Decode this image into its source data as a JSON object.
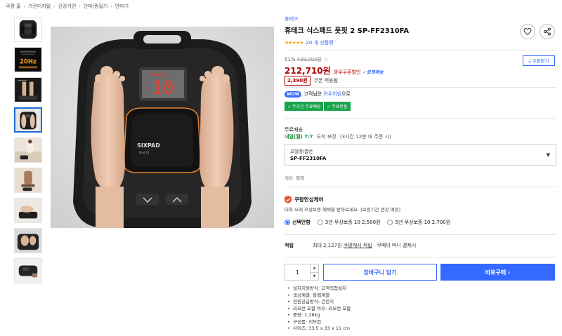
{
  "breadcrumb": [
    "쿠팡 홈",
    "가전디지털",
    "건강가전",
    "안마/찜질기",
    "안마기"
  ],
  "product": {
    "brand": "휴테크",
    "title": "휴테크 식스패드 풋핏 2 SP-FF2310FA",
    "stars": "★★★★★",
    "review_count": "20 개 상품평"
  },
  "price": {
    "discount_rate": "51%",
    "original": "439,000원",
    "info_icon": "ⓘ",
    "sale": "212,710원",
    "coupon_label": "와우쿠폰할인",
    "rocket": "✓로켓배송",
    "coupon_tag": "2,390원",
    "coupon_apply": "쿠폰 적용됨",
    "coupon_button": "⤓ 쿠폰받기"
  },
  "wow": {
    "badge": "WOW",
    "prefix": "고객님은 ",
    "highlight": "와우회원",
    "suffix": "으로"
  },
  "benefits": [
    "✓ 무조건 무료배송",
    "✓ 무료반품"
  ],
  "shipping": {
    "label": "무료배송",
    "date": "내일(월) 7/7",
    "guarantee": "도착 보장",
    "note": "(3시간 12분 내 주문 시)"
  },
  "option": {
    "label1": "모델명/품번",
    "label2": "SP-FF2310FA",
    "caret": "▼"
  },
  "color": "색상: 블랙",
  "care": {
    "title": "쿠팡안심케어",
    "desc": "더욱 오래 무상보증 혜택을 받아보세요. (보증기간 연장 예정)",
    "options": [
      {
        "label": "선택안함",
        "checked": true
      },
      {
        "label": "3년 무상보증 10 2,500원",
        "checked": false
      },
      {
        "label": "5년 무상보증 10 2,700원",
        "checked": false
      }
    ]
  },
  "points": {
    "label": "적립",
    "prefix": "최대 2,127원 ",
    "link": "쿠팡캐시 적립",
    "suffix": " · 쿠페이 머니 결제시"
  },
  "purchase": {
    "quantity": "1",
    "up": "▲",
    "down": "▼",
    "cart": "장바구니 담기",
    "buy": "바로구매 ›"
  },
  "specs": [
    "설치지원방식: 고객직접설치",
    "색상계열: 블랙계열",
    "전원공급방식: 건전지",
    "리모컨 포함 여부: 리모컨 포함",
    "중량: 1.28kg",
    "구성품: 리모컨",
    "사이즈: 33.5 x 33 x 11 cm"
  ],
  "colors": {
    "accent": "#346aff",
    "price_red": "#ae0000",
    "benefit_green": "#19a34a",
    "display_red": "#f23a2a",
    "glow_orange": "#f08a30"
  },
  "main_image": {
    "display_value": "10",
    "display_label": "TRAINING",
    "brand_logo": "SIXPAD",
    "model_text": "Foot Fit"
  },
  "thumbs": [
    {
      "name": "thumb-device-top",
      "selected": false
    },
    {
      "name": "thumb-20hz-banner",
      "selected": false,
      "text": "20Hz"
    },
    {
      "name": "thumb-legs-dark",
      "selected": false
    },
    {
      "name": "thumb-feet-on-device",
      "selected": true
    },
    {
      "name": "thumb-woman-sofa",
      "selected": false
    },
    {
      "name": "thumb-woman-chair",
      "selected": false
    },
    {
      "name": "thumb-feet-side",
      "selected": false
    },
    {
      "name": "thumb-feet-closeup",
      "selected": false
    },
    {
      "name": "thumb-device-side",
      "selected": false
    }
  ]
}
